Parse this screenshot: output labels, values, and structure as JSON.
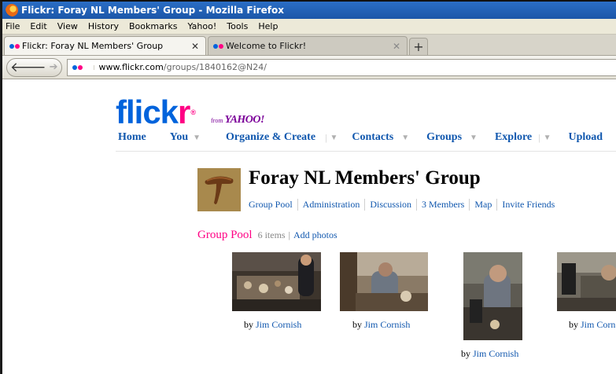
{
  "window": {
    "title": "Flickr: Foray NL Members' Group - Mozilla Firefox"
  },
  "menu": [
    "File",
    "Edit",
    "View",
    "History",
    "Bookmarks",
    "Yahoo!",
    "Tools",
    "Help"
  ],
  "tabs": [
    {
      "label": "Flickr: Foray NL Members' Group",
      "active": true
    },
    {
      "label": "Welcome to Flickr!",
      "active": false
    }
  ],
  "url": {
    "host": "www.flickr.com",
    "path": "/groups/1840162@N24/"
  },
  "logo": {
    "flick": "flick",
    "r": "r",
    "from": "from",
    "yahoo": "YAHOO!"
  },
  "nav": [
    "Home",
    "You",
    "Organize & Create",
    "Contacts",
    "Groups",
    "Explore",
    "Upload"
  ],
  "group": {
    "title": "Foray NL Members' Group",
    "links": [
      "Group Pool",
      "Administration",
      "Discussion",
      "3 Members",
      "Map",
      "Invite Friends"
    ]
  },
  "pool": {
    "title": "Group Pool",
    "count": "6 items",
    "sep": "|",
    "add": "Add photos",
    "by": "by",
    "photos": [
      {
        "author": "Jim Cornish"
      },
      {
        "author": "Jim Cornish"
      },
      {
        "author": "Jim Cornish"
      },
      {
        "author": "Jim Corn"
      }
    ]
  },
  "colors": {
    "flickr_blue": "#0063dc",
    "flickr_pink": "#ff0084",
    "link": "#1057ae"
  }
}
